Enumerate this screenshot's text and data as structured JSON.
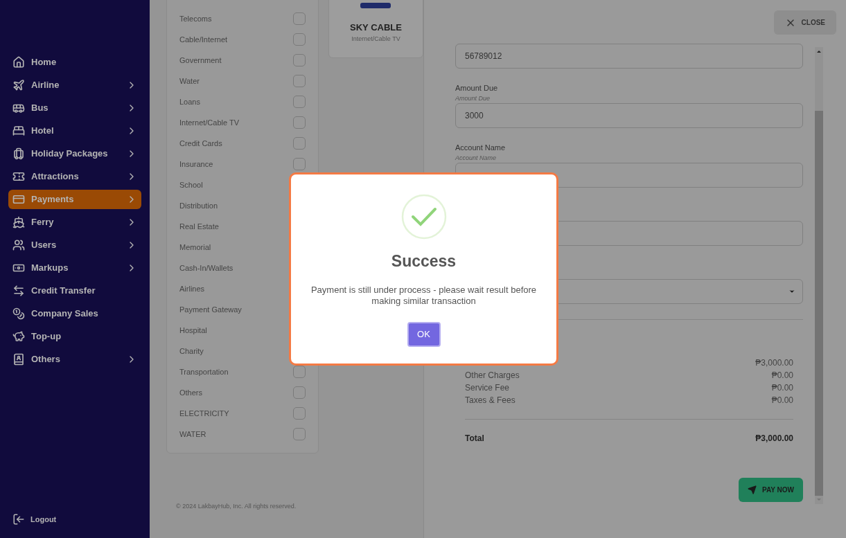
{
  "sidebar": {
    "items": [
      {
        "label": "Home",
        "submenu": false,
        "selected": false
      },
      {
        "label": "Airline",
        "submenu": true,
        "selected": false
      },
      {
        "label": "Bus",
        "submenu": true,
        "selected": false
      },
      {
        "label": "Hotel",
        "submenu": true,
        "selected": false
      },
      {
        "label": "Holiday Packages",
        "submenu": true,
        "selected": false
      },
      {
        "label": "Attractions",
        "submenu": true,
        "selected": false
      },
      {
        "label": "Payments",
        "submenu": true,
        "selected": true
      },
      {
        "label": "Ferry",
        "submenu": true,
        "selected": false
      },
      {
        "label": "Users",
        "submenu": true,
        "selected": false
      },
      {
        "label": "Markups",
        "submenu": true,
        "selected": false
      },
      {
        "label": "Credit Transfer",
        "submenu": false,
        "selected": false
      },
      {
        "label": "Company Sales",
        "submenu": false,
        "selected": false
      },
      {
        "label": "Top-up",
        "submenu": false,
        "selected": false
      },
      {
        "label": "Others",
        "submenu": true,
        "selected": false
      }
    ],
    "logout": "Logout"
  },
  "categories": [
    {
      "label": "Telecoms",
      "checked": false
    },
    {
      "label": "Cable/Internet",
      "checked": false
    },
    {
      "label": "Government",
      "checked": false
    },
    {
      "label": "Water",
      "checked": false
    },
    {
      "label": "Loans",
      "checked": false
    },
    {
      "label": "Internet/Cable TV",
      "checked": false
    },
    {
      "label": "Credit Cards",
      "checked": false
    },
    {
      "label": "Insurance",
      "checked": false
    },
    {
      "label": "School"
    },
    {
      "label": "Distribution"
    },
    {
      "label": "Real Estate"
    },
    {
      "label": "Memorial"
    },
    {
      "label": "Cash-In/Wallets"
    },
    {
      "label": "Airlines"
    },
    {
      "label": "Payment Gateway"
    },
    {
      "label": "Hospital"
    },
    {
      "label": "Charity"
    },
    {
      "label": "Transportation",
      "checked": false
    },
    {
      "label": "Others",
      "checked": false
    },
    {
      "label": "ELECTRICITY",
      "checked": false
    },
    {
      "label": "WATER",
      "checked": false
    }
  ],
  "biller": {
    "name": "SKY CABLE",
    "category": "Internet/Cable TV"
  },
  "footer": "© 2024 LakbayHub, Inc. All rights reserved.",
  "panel": {
    "close": "CLOSE",
    "fields": [
      {
        "kind": "text",
        "value": "56789012"
      },
      {
        "kind": "text",
        "label": "Amount Due",
        "hint": "Amount Due",
        "value": "3000"
      },
      {
        "kind": "text",
        "label": "Account Name",
        "hint": "Account Name"
      },
      {
        "kind": "text"
      },
      {
        "kind": "select"
      }
    ],
    "summary": [
      {
        "value": "₱3,000.00"
      },
      {
        "label": "Other Charges",
        "value": "₱0.00"
      },
      {
        "label": "Service Fee",
        "value": "₱0.00"
      },
      {
        "label": "Taxes & Fees",
        "value": "₱0.00"
      }
    ],
    "total": {
      "label": "Total",
      "value": "₱3,000.00"
    },
    "pay": "PAY NOW"
  },
  "dialog": {
    "title": "Success",
    "message": "Payment is still under process - please wait result before making similar transaction",
    "ok": "OK"
  }
}
